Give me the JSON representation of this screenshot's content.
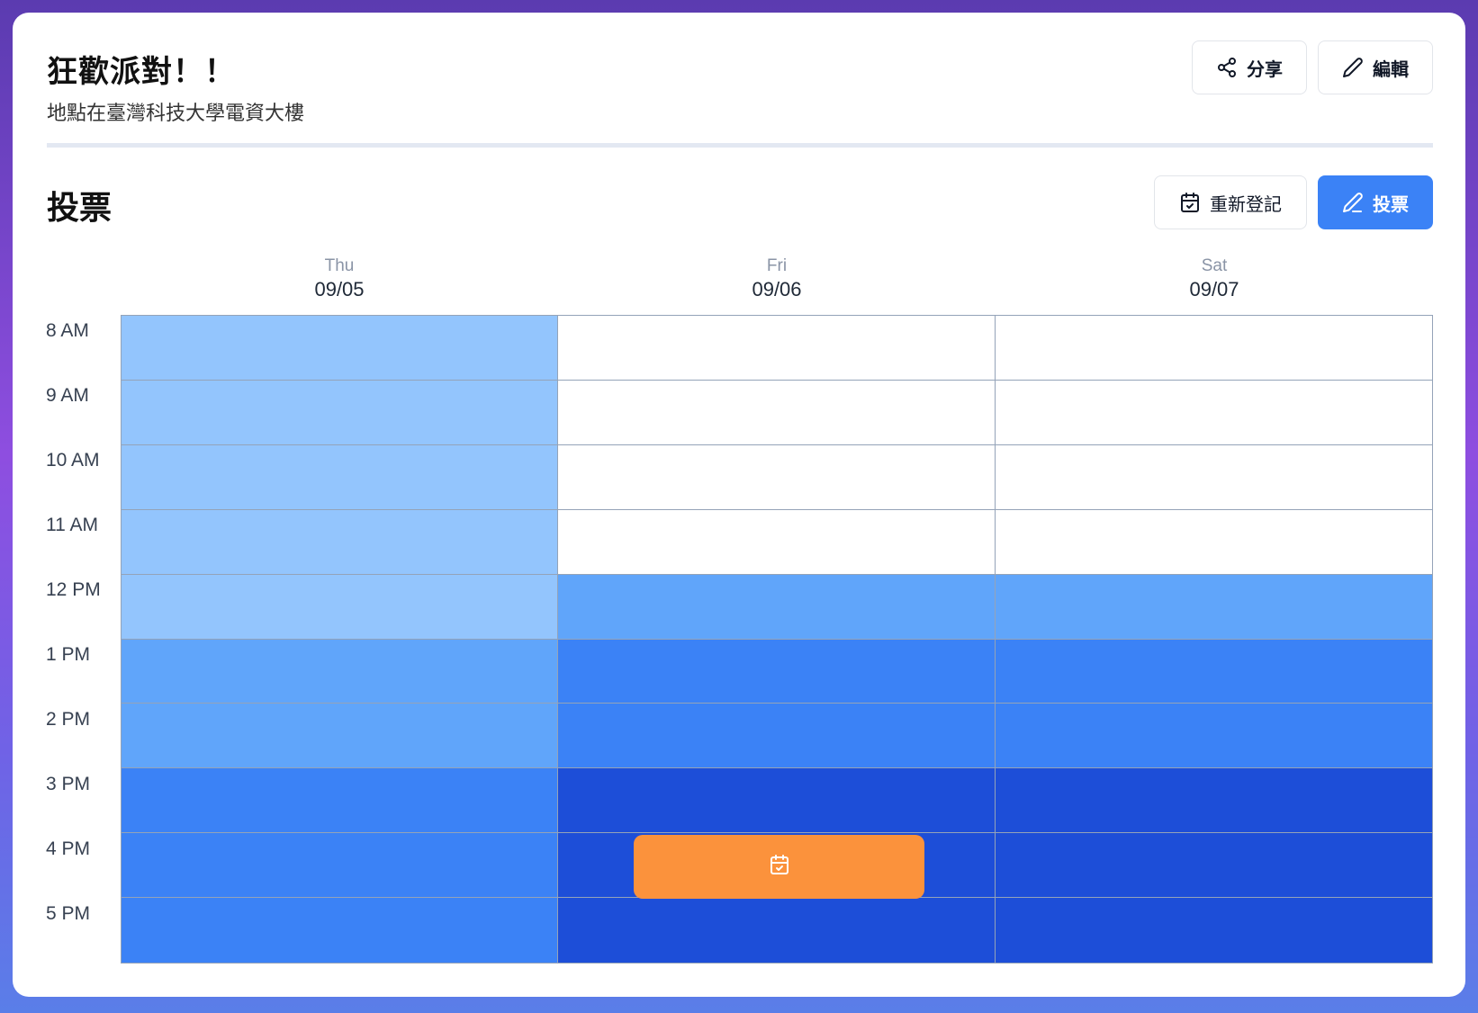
{
  "event": {
    "title": "狂歡派對！！",
    "description": "地點在臺灣科技大學電資大樓"
  },
  "header_actions": {
    "share_label": "分享",
    "share_icon": "share-icon",
    "edit_label": "編輯",
    "edit_icon": "pencil-icon"
  },
  "voting": {
    "title": "投票",
    "reregister_label": "重新登記",
    "reregister_icon": "calendar-icon",
    "vote_label": "投票",
    "vote_icon": "pencil-icon"
  },
  "schedule": {
    "days": [
      {
        "name": "Thu",
        "date": "09/05"
      },
      {
        "name": "Fri",
        "date": "09/06"
      },
      {
        "name": "Sat",
        "date": "09/07"
      }
    ],
    "times": [
      "8 AM",
      "9 AM",
      "10 AM",
      "11 AM",
      "12 PM",
      "1 PM",
      "2 PM",
      "3 PM",
      "4 PM",
      "5 PM"
    ],
    "availability_levels": [
      [
        1,
        0,
        0
      ],
      [
        1,
        0,
        0
      ],
      [
        1,
        0,
        0
      ],
      [
        1,
        0,
        0
      ],
      [
        1,
        2,
        2
      ],
      [
        2,
        3,
        3
      ],
      [
        2,
        3,
        3
      ],
      [
        3,
        4,
        4
      ],
      [
        3,
        4,
        4
      ],
      [
        3,
        4,
        4
      ]
    ],
    "booked_slot": {
      "day": "Fri",
      "time": "4 PM",
      "icon": "calendar-check-icon"
    }
  },
  "colors": {
    "accent": "#3b82f6",
    "booked": "#fb923c",
    "level_0": "#ffffff",
    "level_1": "#93c5fd",
    "level_2": "#60a5fa",
    "level_3": "#3b82f6",
    "level_4": "#1d4ed8"
  }
}
